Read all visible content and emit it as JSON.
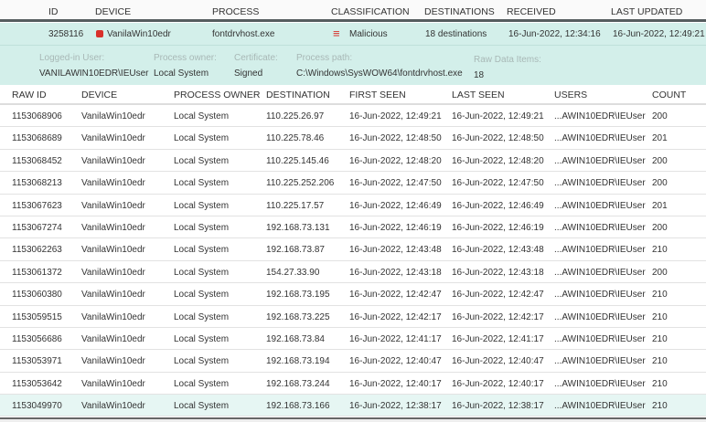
{
  "columns": [
    "ID",
    "DEVICE",
    "PROCESS",
    "CLASSIFICATION",
    "DESTINATIONS",
    "RECEIVED",
    "LAST UPDATED"
  ],
  "alert": {
    "id": "3258116",
    "device": "VanilaWin10edr",
    "process": "fontdrvhost.exe",
    "classification": "Malicious",
    "destinations": "18 destinations",
    "received": "16-Jun-2022, 12:34:16",
    "last_updated": "16-Jun-2022, 12:49:21",
    "malicious_color": "#d9302a"
  },
  "details": [
    {
      "label": "Logged-in User:",
      "value": "VANILAWIN10EDR\\IEUser"
    },
    {
      "label": "Process owner:",
      "value": "Local System"
    },
    {
      "label": "Certificate:",
      "value": "Signed"
    },
    {
      "label": "Process path:",
      "value": "C:\\Windows\\SysWOW64\\fontdrvhost.exe"
    },
    {
      "label": "Raw Data Items:",
      "value": "18"
    }
  ],
  "raw_columns": [
    "RAW ID",
    "DEVICE",
    "PROCESS OWNER",
    "DESTINATION",
    "FIRST SEEN",
    "LAST SEEN",
    "USERS",
    "COUNT"
  ],
  "rows": [
    [
      "1153068906",
      "VanilaWin10edr",
      "Local System",
      "110.225.26.97",
      "16-Jun-2022, 12:49:21",
      "16-Jun-2022, 12:49:21",
      "...AWIN10EDR\\IEUser",
      "200"
    ],
    [
      "1153068689",
      "VanilaWin10edr",
      "Local System",
      "110.225.78.46",
      "16-Jun-2022, 12:48:50",
      "16-Jun-2022, 12:48:50",
      "...AWIN10EDR\\IEUser",
      "201"
    ],
    [
      "1153068452",
      "VanilaWin10edr",
      "Local System",
      "110.225.145.46",
      "16-Jun-2022, 12:48:20",
      "16-Jun-2022, 12:48:20",
      "...AWIN10EDR\\IEUser",
      "200"
    ],
    [
      "1153068213",
      "VanilaWin10edr",
      "Local System",
      "110.225.252.206",
      "16-Jun-2022, 12:47:50",
      "16-Jun-2022, 12:47:50",
      "...AWIN10EDR\\IEUser",
      "200"
    ],
    [
      "1153067623",
      "VanilaWin10edr",
      "Local System",
      "110.225.17.57",
      "16-Jun-2022, 12:46:49",
      "16-Jun-2022, 12:46:49",
      "...AWIN10EDR\\IEUser",
      "201"
    ],
    [
      "1153067274",
      "VanilaWin10edr",
      "Local System",
      "192.168.73.131",
      "16-Jun-2022, 12:46:19",
      "16-Jun-2022, 12:46:19",
      "...AWIN10EDR\\IEUser",
      "200"
    ],
    [
      "1153062263",
      "VanilaWin10edr",
      "Local System",
      "192.168.73.87",
      "16-Jun-2022, 12:43:48",
      "16-Jun-2022, 12:43:48",
      "...AWIN10EDR\\IEUser",
      "210"
    ],
    [
      "1153061372",
      "VanilaWin10edr",
      "Local System",
      "154.27.33.90",
      "16-Jun-2022, 12:43:18",
      "16-Jun-2022, 12:43:18",
      "...AWIN10EDR\\IEUser",
      "200"
    ],
    [
      "1153060380",
      "VanilaWin10edr",
      "Local System",
      "192.168.73.195",
      "16-Jun-2022, 12:42:47",
      "16-Jun-2022, 12:42:47",
      "...AWIN10EDR\\IEUser",
      "210"
    ],
    [
      "1153059515",
      "VanilaWin10edr",
      "Local System",
      "192.168.73.225",
      "16-Jun-2022, 12:42:17",
      "16-Jun-2022, 12:42:17",
      "...AWIN10EDR\\IEUser",
      "210"
    ],
    [
      "1153056686",
      "VanilaWin10edr",
      "Local System",
      "192.168.73.84",
      "16-Jun-2022, 12:41:17",
      "16-Jun-2022, 12:41:17",
      "...AWIN10EDR\\IEUser",
      "210"
    ],
    [
      "1153053971",
      "VanilaWin10edr",
      "Local System",
      "192.168.73.194",
      "16-Jun-2022, 12:40:47",
      "16-Jun-2022, 12:40:47",
      "...AWIN10EDR\\IEUser",
      "210"
    ],
    [
      "1153053642",
      "VanilaWin10edr",
      "Local System",
      "192.168.73.244",
      "16-Jun-2022, 12:40:17",
      "16-Jun-2022, 12:40:17",
      "...AWIN10EDR\\IEUser",
      "210"
    ],
    [
      "1153049970",
      "VanilaWin10edr",
      "Local System",
      "192.168.73.166",
      "16-Jun-2022, 12:38:17",
      "16-Jun-2022, 12:38:17",
      "...AWIN10EDR\\IEUser",
      "210"
    ]
  ]
}
